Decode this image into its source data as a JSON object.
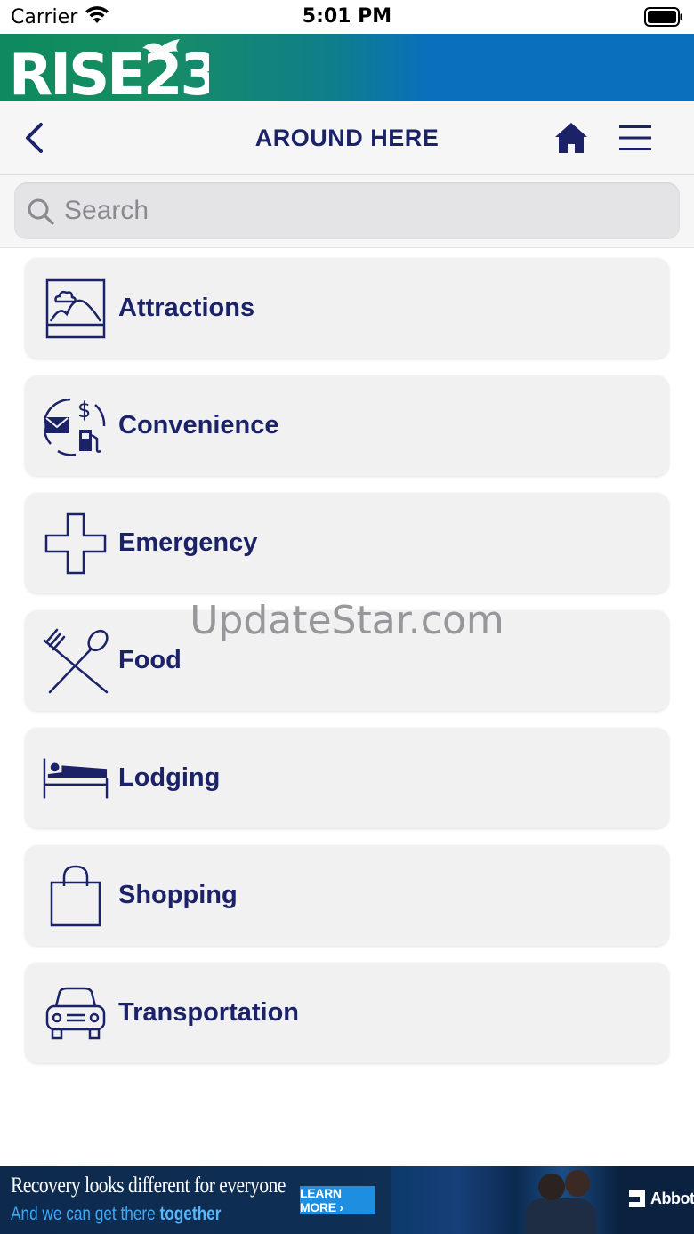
{
  "status_bar": {
    "carrier": "Carrier",
    "time": "5:01 PM"
  },
  "brand": {
    "logo_text": "RISE23",
    "gradient_start": "#0d8a5f",
    "gradient_end": "#0a6fbd"
  },
  "nav": {
    "title": "AROUND HERE",
    "back_icon": "chevron-left-icon",
    "home_icon": "home-icon",
    "menu_icon": "hamburger-menu-icon"
  },
  "search": {
    "placeholder": "Search",
    "value": ""
  },
  "categories": [
    {
      "label": "Attractions",
      "icon": "landscape-picture-icon"
    },
    {
      "label": "Convenience",
      "icon": "mail-dollar-fuel-icon"
    },
    {
      "label": "Emergency",
      "icon": "medical-cross-icon"
    },
    {
      "label": "Food",
      "icon": "fork-spoon-icon"
    },
    {
      "label": "Lodging",
      "icon": "bed-icon"
    },
    {
      "label": "Shopping",
      "icon": "shopping-bag-icon"
    },
    {
      "label": "Transportation",
      "icon": "car-icon"
    }
  ],
  "watermark": "UpdateStar.com",
  "ad": {
    "headline": "Recovery looks different for everyone",
    "subline_prefix": "And we can get there ",
    "subline_emphasis": "together",
    "cta": "LEARN MORE ›",
    "brand": "Abbott"
  },
  "colors": {
    "primary_text": "#1b2268",
    "item_background": "#f1f1f2",
    "search_background": "#e4e4e6"
  }
}
